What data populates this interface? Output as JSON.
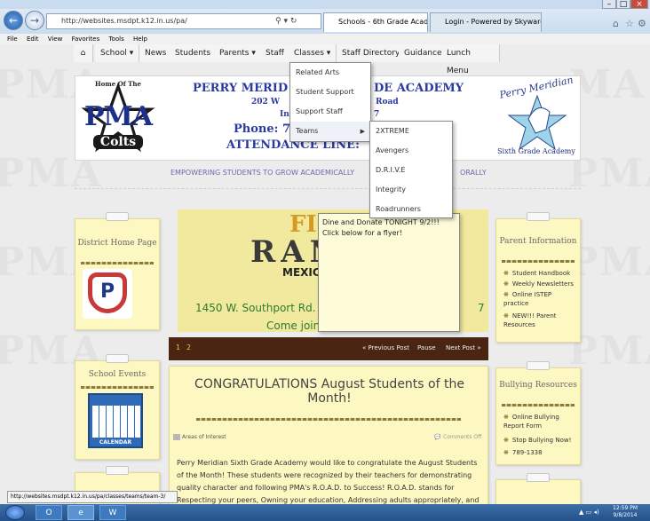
{
  "browser": {
    "url": "http://websites.msdpt.k12.in.us/pa/",
    "tabs": [
      {
        "label": "Schools - 6th Grade Acade..."
      },
      {
        "label": "Login - Powered by Skyward"
      }
    ],
    "menu": [
      "File",
      "Edit",
      "View",
      "Favorites",
      "Tools",
      "Help"
    ],
    "status_url": "http://websites.msdpt.k12.in.us/pa/classes/teams/team-3/"
  },
  "site": {
    "nav": [
      "School",
      "News",
      "Students",
      "Parents",
      "Staff",
      "Classes",
      "Staff Directory",
      "Guidance",
      "Lunch Menu"
    ],
    "classes_menu": [
      "Related Arts",
      "Student Support",
      "Support Staff",
      "Teams"
    ],
    "teams_menu": [
      "2XTREME",
      "Avengers",
      "D.R.I.V.E",
      "Integrity",
      "Roadrunners"
    ],
    "banner": {
      "logo_top": "Home Of The",
      "logo_main": "PMA",
      "logo_bottom": "Colts",
      "title": "PERRY MERID",
      "title_right": "DE ACADEMY",
      "addr1": "202 W",
      "addr1_right": "Road",
      "addr2": "In",
      "addr2_right": "7",
      "phone": "Phone: 7",
      "attendance": "ATTENDANCE LINE:",
      "right_logo_arc": "Perry Meridian",
      "right_logo_sub": "Sixth Grade Academy"
    },
    "tagline_left": "EMPOWERING STUDENTS TO GROW ACADEMICALLY",
    "tagline_right": "ORALLY"
  },
  "left_cards": [
    {
      "title": "District Home Page"
    },
    {
      "title": "School Events",
      "calendar_label": "CALENDAR"
    }
  ],
  "right_cards": [
    {
      "title": "Parent Information",
      "links": [
        "Student Handbook",
        "Weekly Newsletters",
        "Online ISTEP practice",
        "NEW!!! Parent Resources"
      ]
    },
    {
      "title": "Bullying Resources",
      "links": [
        "Online Bullying Report Form",
        "Stop Bullying Now!",
        "789-1338"
      ]
    }
  ],
  "slider": {
    "headline_1": "FI",
    "headline_2": "RAN",
    "sub": "MEXIC",
    "address": "1450 W. Southport Rd.",
    "address_right": "7",
    "cta": "Come join us for lunch or dinner",
    "pages": [
      "1",
      "2"
    ],
    "controls": [
      "« Previous Post",
      "Pause",
      "Next Post »"
    ],
    "popup": "Dine and Donate TONIGHT 9/2!!! Click below for a flyer!"
  },
  "post": {
    "title": "CONGRATULATIONS August Students of the Month!",
    "category": "Areas of Interest",
    "comments": "Comments Off",
    "body": "Perry Meridian Sixth Grade Academy would like to congratulate the August Students of the Month! These students were recognized by their teachers for demonstrating quality character and following PMA's R.O.A.D. to Success! R.O.A.D. stands for Respecting your peers, Owning your education, Addressing adults appropriately, and"
  },
  "taskbar": {
    "time": "12:59 PM",
    "date": "9/8/2014"
  },
  "colors": {
    "accent": "#3a55a8",
    "card": "#fdf8c2",
    "slider_bar": "#4a2512"
  }
}
